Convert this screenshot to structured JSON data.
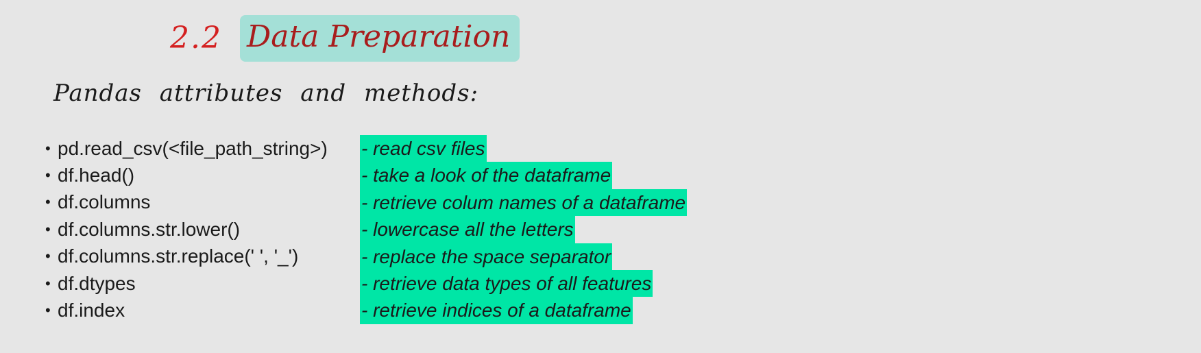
{
  "heading": {
    "number": "2.2",
    "title": "Data Preparation"
  },
  "subheading": "Pandas attributes and methods:",
  "items": [
    {
      "bullet": "•",
      "method": "pd.read_csv(<file_path_string>)",
      "description": "- read csv files"
    },
    {
      "bullet": "•",
      "method": "df.head()",
      "description": "- take a look of the dataframe"
    },
    {
      "bullet": "•",
      "method": "df.columns",
      "description": "- retrieve colum names of a dataframe"
    },
    {
      "bullet": "•",
      "method": "df.columns.str.lower()",
      "description": "- lowercase all the letters"
    },
    {
      "bullet": "•",
      "method": "df.columns.str.replace(' ', '_')",
      "description": "- replace the space separator"
    },
    {
      "bullet": "•",
      "method": "df.dtypes",
      "description": "- retrieve data types of all features"
    },
    {
      "bullet": "•",
      "method": "df.index",
      "description": "- retrieve indices of a dataframe"
    }
  ],
  "colors": {
    "background": "#e6e6e6",
    "section_number": "#d42020",
    "section_title": "#a81d1d",
    "title_highlight": "#78dccd",
    "description_highlight": "#00e6a6"
  }
}
